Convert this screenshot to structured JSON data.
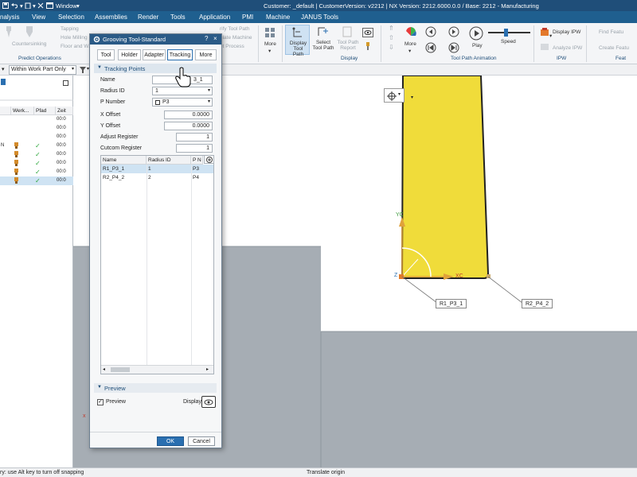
{
  "titlebar": {
    "window_label": "Window",
    "title": "Customer: _default | CustomerVersion: v2212 | NX Version: 2212.6000.0.0 / Base: 2212 - Manufacturing"
  },
  "menu": {
    "items": [
      "nalysis",
      "View",
      "Selection",
      "Assemblies",
      "Render",
      "Tools",
      "Application",
      "PMI",
      "Machine",
      "JANUS Tools"
    ]
  },
  "ribbon": {
    "left_items": [
      "Countersinking",
      "Tapping",
      "Hole Milling",
      "Floor and W..."
    ],
    "fade_items": [
      "rify Tool Path",
      "ulate Machine",
      "et Process"
    ],
    "more_label": "More",
    "display_tool_path": "Display Tool Path",
    "select_tool_path": "Select Tool Path",
    "tool_path_report": "Tool Path Report",
    "more2_label": "More",
    "play_label": "Play",
    "speed_label": "Speed",
    "display_ipw": "Display IPW",
    "analyze_ipw": "Analyze IPW",
    "find_feature": "Find Featu",
    "create_feature": "Create Featu",
    "groups": {
      "predict": "Predict Operations",
      "display": "Display",
      "animation": "Tool Path Animation",
      "ipw": "IPW",
      "feat": "Feat"
    }
  },
  "toolbar2": {
    "filter_value": "Within Work Part Only",
    "search_placeholder": "Type"
  },
  "navigator": {
    "columns": [
      "Werk...",
      "Pfad",
      "Zeit"
    ],
    "rows": [
      {
        "time": "00:0",
        "check": false,
        "tool": false,
        "selected": false,
        "prefix": ""
      },
      {
        "time": "00:0",
        "check": false,
        "tool": false,
        "selected": false,
        "prefix": ""
      },
      {
        "time": "00:0",
        "check": false,
        "tool": false,
        "selected": false,
        "prefix": ""
      },
      {
        "time": "00:0",
        "check": true,
        "tool": true,
        "selected": false,
        "prefix": "N"
      },
      {
        "time": "00:0",
        "check": true,
        "tool": true,
        "selected": false,
        "prefix": ""
      },
      {
        "time": "00:0",
        "check": true,
        "tool": true,
        "selected": false,
        "prefix": ""
      },
      {
        "time": "00:0",
        "check": true,
        "tool": true,
        "selected": false,
        "prefix": ""
      },
      {
        "time": "00:0",
        "check": true,
        "tool": true,
        "selected": true,
        "prefix": ""
      }
    ]
  },
  "dialog": {
    "title": "Grooving Tool-Standard",
    "tabs": [
      "Tool",
      "Holder",
      "Adapter",
      "Tracking",
      "More"
    ],
    "active_tab": "Tracking",
    "tracking_section": "Tracking Points",
    "name_label": "Name",
    "name_value": "3_1",
    "radius_id_label": "Radius ID",
    "radius_id_value": "1",
    "p_number_label": "P Number",
    "p_number_value": "P3",
    "x_offset_label": "X Offset",
    "x_offset_value": "0.0000",
    "y_offset_label": "Y Offset",
    "y_offset_value": "0.0000",
    "adjust_register_label": "Adjust Register",
    "adjust_register_value": "1",
    "cutcom_register_label": "Cutcom Register",
    "cutcom_register_value": "1",
    "table": {
      "columns": [
        "Name",
        "Radius ID",
        "P N"
      ],
      "rows": [
        {
          "name": "R1_P3_1",
          "radius": "1",
          "p": "P3"
        },
        {
          "name": "R2_P4_2",
          "radius": "2",
          "p": "P4"
        }
      ]
    },
    "preview_section": "Preview",
    "preview_label": "Preview",
    "display_label": "Display",
    "ok_label": "OK",
    "cancel_label": "Cancel"
  },
  "graphics": {
    "callout_1": "R1_P3_1",
    "callout_2": "R2_P4_2",
    "axis_y": "YC",
    "axis_x": "XC",
    "axis_z": "Z",
    "x_marker": "x",
    "fill_color": "#f0dc3a",
    "body_color": "#a3aab1"
  },
  "status": {
    "left": "ry: use Alt key to turn off snapping",
    "center": "Translate origin"
  }
}
